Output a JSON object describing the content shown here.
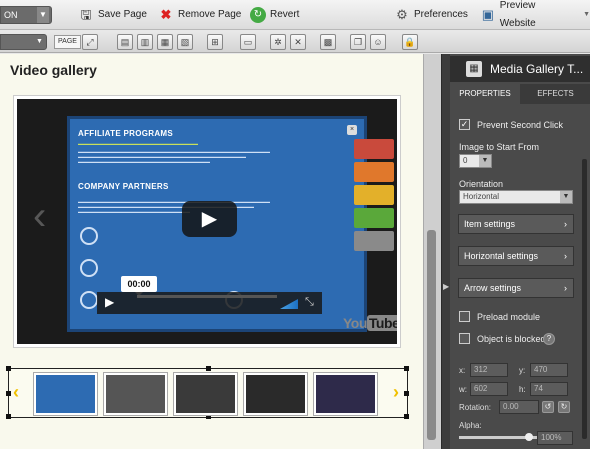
{
  "toolbar": {
    "selector_value": "ON",
    "save_label": "Save Page",
    "remove_label": "Remove Page",
    "revert_label": "Revert",
    "preferences_label": "Preferences",
    "preview_label": "Preview Website"
  },
  "toolbar2": {
    "page_label": "PAGE"
  },
  "canvas": {
    "title": "Video gallery",
    "video": {
      "slide_heading1": "AFFILIATE PROGRAMS",
      "slide_heading2": "COMPANY PARTNERS",
      "time_tooltip": "00:00",
      "progress_fraction": 0,
      "logo_text_you": "You",
      "logo_text_tube": "Tube",
      "tab_colors": [
        "#c94a3c",
        "#e0782c",
        "#e3b02a",
        "#5aa83a",
        "#8a8a8a"
      ]
    },
    "thumbnails": [
      "thumb1",
      "thumb2",
      "thumb3",
      "thumb4",
      "thumb5"
    ]
  },
  "panel": {
    "title": "Media Gallery T...",
    "tabs": [
      "PROPERTIES",
      "EFFECTS"
    ],
    "prevent_second_click": "Prevent Second Click",
    "prevent_second_click_checked": true,
    "image_start_label": "Image to Start From",
    "image_start_value": "0",
    "orientation_label": "Orientation",
    "orientation_value": "Horizontal",
    "item_settings": "Item settings",
    "horizontal_settings": "Horizontal settings",
    "arrow_settings": "Arrow settings",
    "preload_module": "Preload module",
    "object_blocked": "Object is blocked",
    "help_glyph": "?",
    "x_label": "x:",
    "x_value": "312",
    "y_label": "y:",
    "y_value": "470",
    "w_label": "w:",
    "w_value": "602",
    "h_label": "h:",
    "h_value": "74",
    "rotation_label": "Rotation:",
    "rotation_value": "0.00",
    "alpha_label": "Alpha:",
    "alpha_value": "100%",
    "alpha_fraction": 1.0
  }
}
